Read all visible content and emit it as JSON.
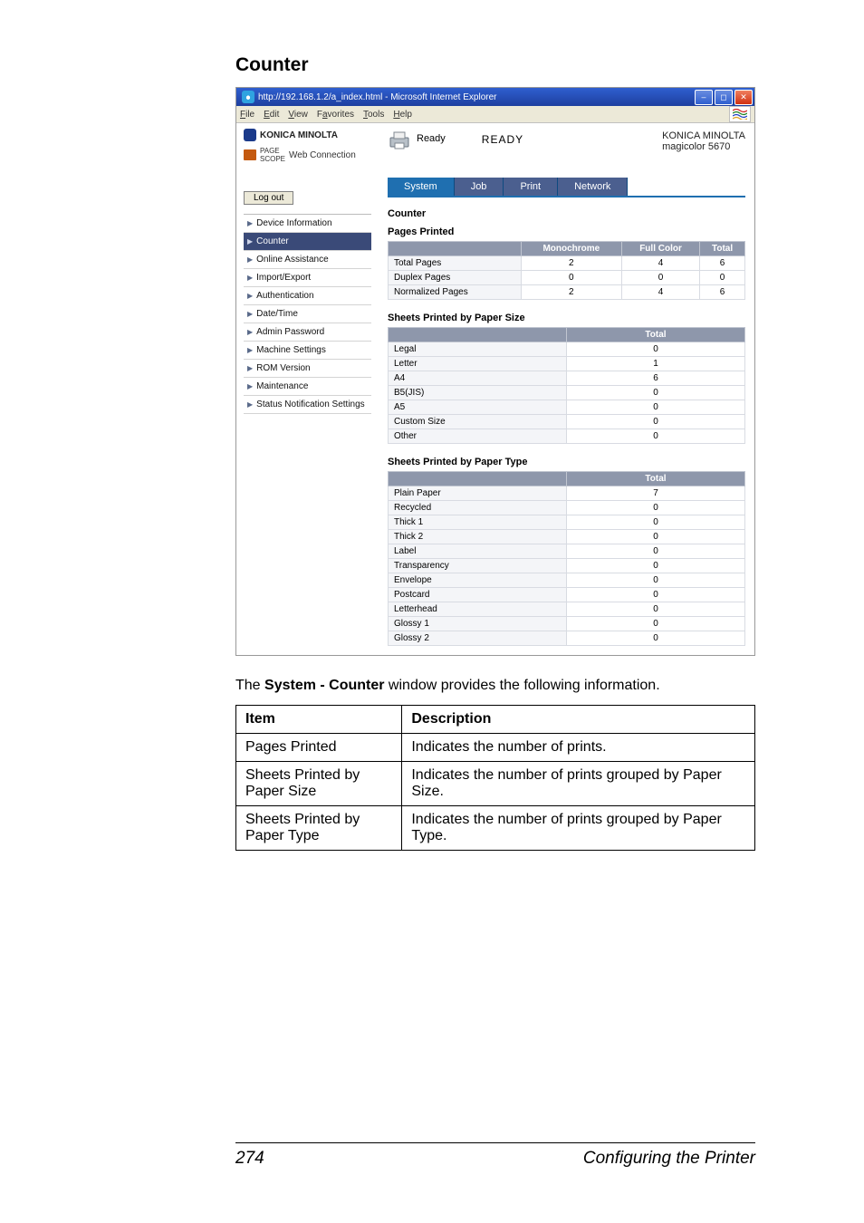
{
  "section_title": "Counter",
  "ie": {
    "url_title": "http://192.168.1.2/a_index.html - Microsoft Internet Explorer",
    "menus": [
      "File",
      "Edit",
      "View",
      "Favorites",
      "Tools",
      "Help"
    ]
  },
  "brand": {
    "name": "KONICA MINOLTA",
    "pagescope": "Web Connection"
  },
  "logout_label": "Log out",
  "nav": [
    {
      "label": "Device Information",
      "active": false
    },
    {
      "label": "Counter",
      "active": true
    },
    {
      "label": "Online Assistance",
      "active": false
    },
    {
      "label": "Import/Export",
      "active": false
    },
    {
      "label": "Authentication",
      "active": false
    },
    {
      "label": "Date/Time",
      "active": false
    },
    {
      "label": "Admin Password",
      "active": false
    },
    {
      "label": "Machine Settings",
      "active": false
    },
    {
      "label": "ROM Version",
      "active": false
    },
    {
      "label": "Maintenance",
      "active": false
    },
    {
      "label": "Status Notification Settings",
      "active": false
    }
  ],
  "status": {
    "ready_small": "Ready",
    "ready_big": "READY",
    "maker": "KONICA MINOLTA",
    "model": "magicolor 5670"
  },
  "tabs": [
    "System",
    "Job",
    "Print",
    "Network"
  ],
  "panel_title": "Counter",
  "pages_printed": {
    "heading": "Pages Printed",
    "cols": [
      "",
      "Monochrome",
      "Full Color",
      "Total"
    ],
    "rows": [
      {
        "label": "Total Pages",
        "mono": "2",
        "full": "4",
        "total": "6"
      },
      {
        "label": "Duplex Pages",
        "mono": "0",
        "full": "0",
        "total": "0"
      },
      {
        "label": "Normalized Pages",
        "mono": "2",
        "full": "4",
        "total": "6"
      }
    ]
  },
  "by_size": {
    "heading": "Sheets Printed by Paper Size",
    "col": "Total",
    "rows": [
      {
        "label": "Legal",
        "val": "0"
      },
      {
        "label": "Letter",
        "val": "1"
      },
      {
        "label": "A4",
        "val": "6"
      },
      {
        "label": "B5(JIS)",
        "val": "0"
      },
      {
        "label": "A5",
        "val": "0"
      },
      {
        "label": "Custom Size",
        "val": "0"
      },
      {
        "label": "Other",
        "val": "0"
      }
    ]
  },
  "by_type": {
    "heading": "Sheets Printed by Paper Type",
    "col": "Total",
    "rows": [
      {
        "label": "Plain Paper",
        "val": "7"
      },
      {
        "label": "Recycled",
        "val": "0"
      },
      {
        "label": "Thick 1",
        "val": "0"
      },
      {
        "label": "Thick 2",
        "val": "0"
      },
      {
        "label": "Label",
        "val": "0"
      },
      {
        "label": "Transparency",
        "val": "0"
      },
      {
        "label": "Envelope",
        "val": "0"
      },
      {
        "label": "Postcard",
        "val": "0"
      },
      {
        "label": "Letterhead",
        "val": "0"
      },
      {
        "label": "Glossy 1",
        "val": "0"
      },
      {
        "label": "Glossy 2",
        "val": "0"
      }
    ]
  },
  "caption_pre": "The ",
  "caption_bold": "System - Counter",
  "caption_post": " window provides the following information.",
  "desc": {
    "head_item": "Item",
    "head_desc": "Description",
    "rows": [
      {
        "item": "Pages Printed",
        "desc": "Indicates the number of prints."
      },
      {
        "item": "Sheets Printed by Paper Size",
        "desc": "Indicates the number of prints grouped by Paper Size."
      },
      {
        "item": "Sheets Printed by Paper Type",
        "desc": "Indicates the number of prints grouped by Paper Type."
      }
    ]
  },
  "footer": {
    "page": "274",
    "title": "Configuring the Printer"
  }
}
